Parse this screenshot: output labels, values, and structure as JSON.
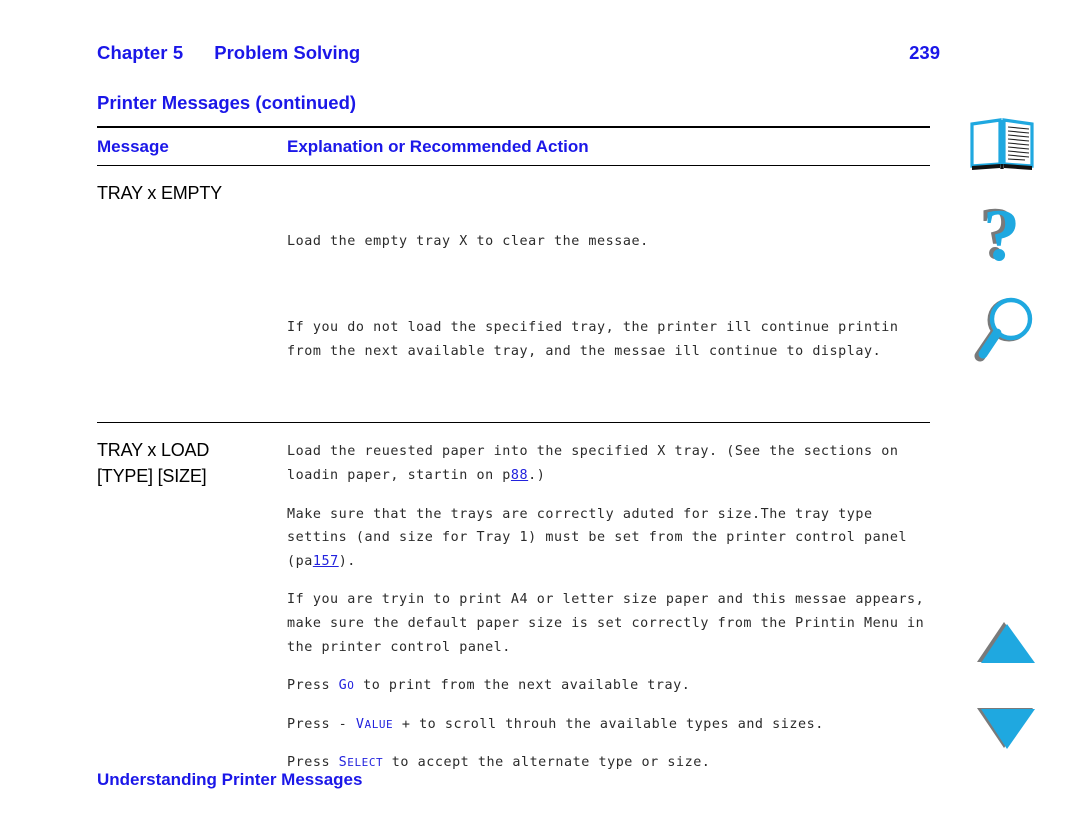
{
  "header": {
    "chapter_label": "Chapter 5",
    "chapter_title": "Problem Solving",
    "page_number": "239"
  },
  "section": {
    "title": "Printer Messages (continued)"
  },
  "table": {
    "columns": {
      "message": "Message",
      "explanation": "Explanation or Recommended Action"
    },
    "rows": [
      {
        "message": "TRAY x EMPTY",
        "paragraphs": [
          "Load the empty tray X to clear the messae.",
          "If you do not load the specified tray, the printer ill continue printin from the next available tray, and the messae ill continue to display."
        ]
      },
      {
        "message": "TRAY x LOAD [TYPE] [SIZE]",
        "message_line1": "TRAY x LOAD",
        "message_line2": "[TYPE] [SIZE]",
        "paragraphs": [
          {
            "parts": [
              {
                "text": "Load the reuested paper into the specified X tray. (See the sections on loadin paper, startin on p"
              },
              {
                "text": "88",
                "style": "link"
              },
              {
                "text": ".)"
              }
            ]
          },
          {
            "parts": [
              {
                "text": "Make sure that the trays are correctly aduted for size.The tray type settins (and size for Tray 1) must be set from the printer control panel (pa"
              },
              {
                "text": "157",
                "style": "link"
              },
              {
                "text": ")."
              }
            ]
          },
          {
            "parts": [
              {
                "text": "If you are tryin to print A4 or letter size paper and this messae appears, make sure the default paper size is set correctly from the Printin Menu in the printer control panel."
              }
            ]
          },
          {
            "parts": [
              {
                "text": "Press "
              },
              {
                "text": "Go",
                "style": "keycap"
              },
              {
                "text": " to print from the next available tray."
              }
            ]
          },
          {
            "parts": [
              {
                "text": "Press - "
              },
              {
                "text": "Value",
                "style": "keycap"
              },
              {
                "text": " + to scroll throuh the available types and sizes."
              }
            ]
          },
          {
            "parts": [
              {
                "text": "Press "
              },
              {
                "text": "Select",
                "style": "keycap"
              },
              {
                "text": " to accept the alternate type or size."
              }
            ]
          }
        ]
      }
    ]
  },
  "footer": {
    "text": "Understanding Printer Messages"
  },
  "icons": {
    "book": "open-book-icon",
    "help": "question-mark-icon",
    "search": "magnifier-icon",
    "up": "triangle-up-icon",
    "down": "triangle-down-icon"
  },
  "colors": {
    "accent_blue": "#1b17e8",
    "link_blue": "#2222dd",
    "icon_cyan": "#1fa8e0",
    "icon_shadow": "#7a7a7a",
    "text_black": "#000000",
    "body_gray": "#2b2b2b"
  }
}
